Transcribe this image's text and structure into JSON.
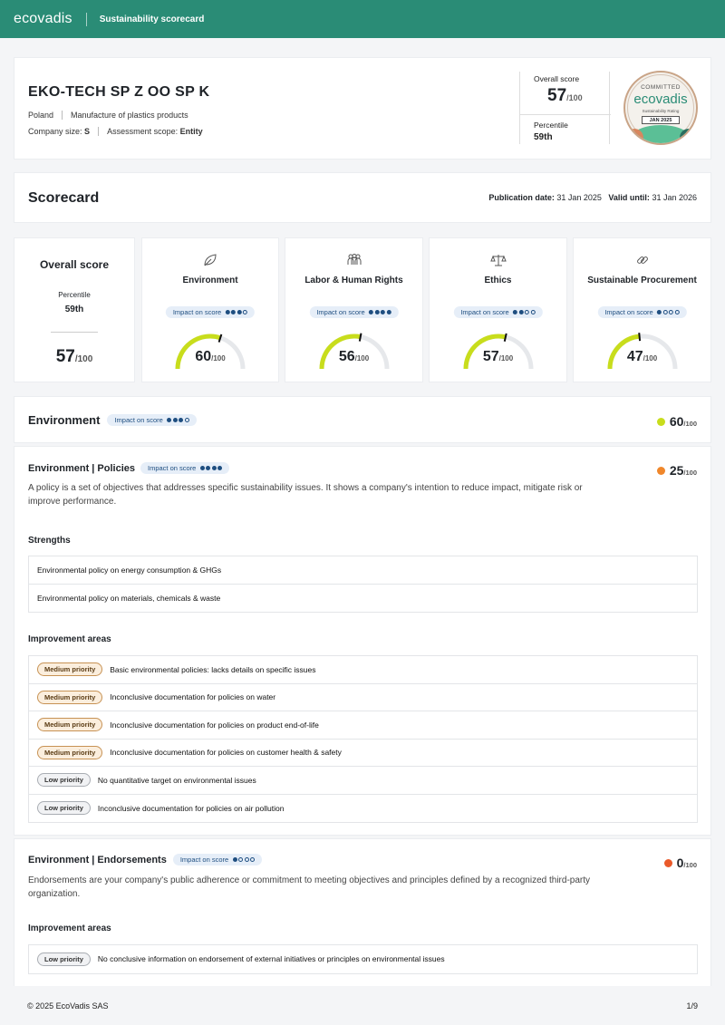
{
  "header": {
    "brand": "ecovadis",
    "title": "Sustainability scorecard"
  },
  "company": {
    "name": "EKO-TECH SP Z OO SP K",
    "country": "Poland",
    "industry": "Manufacture of plastics products",
    "size_label": "Company size:",
    "size_value": "S",
    "scope_label": "Assessment scope:",
    "scope_value": "Entity",
    "overall_label": "Overall score",
    "overall_value": "57",
    "overall_den": "/100",
    "percentile_label": "Percentile",
    "percentile_value": "59th"
  },
  "badge": {
    "top": "COMMITTED",
    "brand": "ecovadis",
    "sub": "Sustainability Rating",
    "date": "JAN 2025"
  },
  "scorecard": {
    "title": "Scorecard",
    "pub_label": "Publication date:",
    "pub_value": "31 Jan 2025",
    "valid_label": "Valid until:",
    "valid_value": "31 Jan 2026"
  },
  "overall_tile": {
    "title": "Overall score",
    "percentile_label": "Percentile",
    "percentile_value": "59th",
    "score": "57",
    "den": "/100"
  },
  "impact_label": "Impact on score",
  "themes": [
    {
      "name": "Environment",
      "icon": "leaf-icon",
      "impact": 3,
      "score": 60,
      "den": "/100"
    },
    {
      "name": "Labor & Human Rights",
      "icon": "people-icon",
      "impact": 4,
      "score": 56,
      "den": "/100"
    },
    {
      "name": "Ethics",
      "icon": "scales-icon",
      "impact": 2,
      "score": 57,
      "den": "/100"
    },
    {
      "name": "Sustainable Procurement",
      "icon": "link-icon",
      "impact": 1,
      "score": 47,
      "den": "/100"
    }
  ],
  "colors": {
    "brand": "#2a8c76",
    "gauge_fill": "#c8dd1c",
    "gauge_track": "#e6e8eb",
    "orange": "#f0872b",
    "red_orange": "#ea5a2a",
    "lime": "#c8dd1c"
  },
  "env_section": {
    "title": "Environment",
    "impact": 3,
    "score": "60",
    "den": "/100"
  },
  "policies": {
    "title": "Environment | Policies",
    "impact": 4,
    "score": "25",
    "den": "/100",
    "description": "A policy is a set of objectives that addresses specific sustainability issues. It shows a company's intention to reduce impact, mitigate risk or improve performance.",
    "strengths_label": "Strengths",
    "strengths": [
      "Environmental policy on energy consumption & GHGs",
      "Environmental policy on materials, chemicals & waste"
    ],
    "improvement_label": "Improvement areas",
    "improvements": [
      {
        "priority": "Medium priority",
        "level": "med",
        "text": "Basic environmental policies: lacks details on specific issues"
      },
      {
        "priority": "Medium priority",
        "level": "med",
        "text": "Inconclusive documentation for policies on water"
      },
      {
        "priority": "Medium priority",
        "level": "med",
        "text": "Inconclusive documentation for policies on product end-of-life"
      },
      {
        "priority": "Medium priority",
        "level": "med",
        "text": "Inconclusive documentation for policies on customer health & safety"
      },
      {
        "priority": "Low priority",
        "level": "low",
        "text": "No quantitative target on environmental issues"
      },
      {
        "priority": "Low priority",
        "level": "low",
        "text": "Inconclusive documentation for policies on air pollution"
      }
    ]
  },
  "endorsements": {
    "title": "Environment | Endorsements",
    "impact": 1,
    "score": "0",
    "den": "/100",
    "description": "Endorsements are your company's public adherence or commitment to meeting objectives and principles defined by a recognized third-party organization.",
    "improvement_label": "Improvement areas",
    "improvements": [
      {
        "priority": "Low priority",
        "level": "low",
        "text": "No conclusive information on endorsement of external initiatives or principles on environmental issues"
      }
    ]
  },
  "footer": {
    "copyright": "© 2025 EcoVadis SAS",
    "page": "1/9"
  }
}
